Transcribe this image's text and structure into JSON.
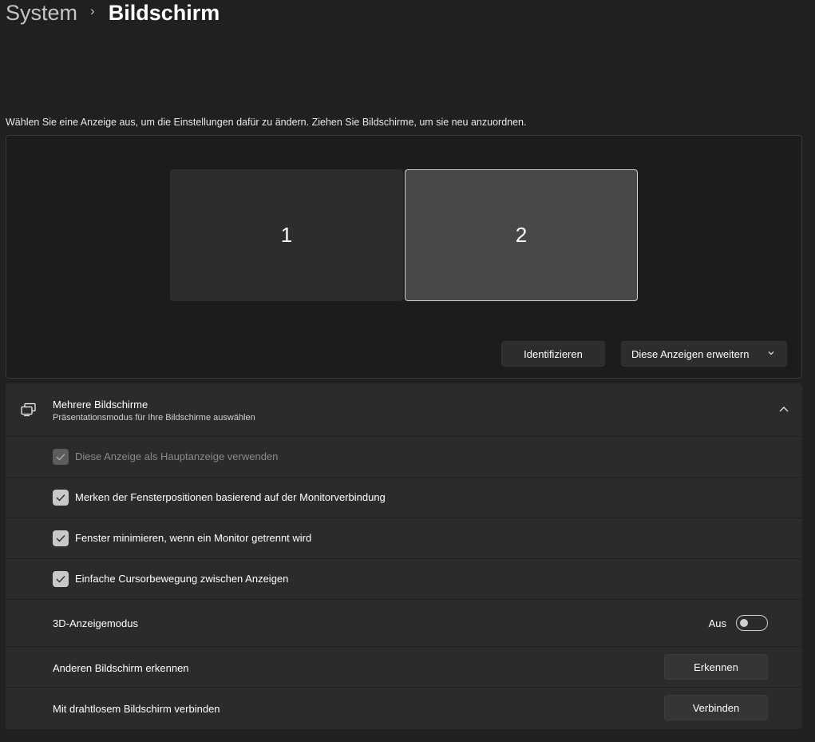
{
  "breadcrumb": {
    "parent": "System",
    "separator": "›",
    "current": "Bildschirm"
  },
  "instruction": "Wählen Sie eine Anzeige aus, um die Einstellungen dafür zu ändern. Ziehen Sie Bildschirme, um sie neu anzuordnen.",
  "arrangement": {
    "monitors": [
      {
        "label": "1",
        "selected": false
      },
      {
        "label": "2",
        "selected": true
      }
    ],
    "identify_label": "Identifizieren",
    "mode_dropdown": {
      "selected": "Diese Anzeigen erweitern",
      "icon": "chevron-down-icon"
    }
  },
  "multiple_displays": {
    "icon": "multiple-displays-icon",
    "title": "Mehrere Bildschirme",
    "subtitle": "Präsentationsmodus für Ihre Bildschirme auswählen",
    "expanded": true,
    "collapse_icon": "chevron-up-icon",
    "checkbox_options": [
      {
        "label": "Diese Anzeige als Hauptanzeige verwenden",
        "checked": true,
        "disabled": true
      },
      {
        "label": "Merken der Fensterpositionen basierend auf der Monitorverbindung",
        "checked": true,
        "disabled": false
      },
      {
        "label": "Fenster minimieren, wenn ein Monitor getrennt wird",
        "checked": true,
        "disabled": false
      },
      {
        "label": "Einfache Cursorbewegung zwischen Anzeigen",
        "checked": true,
        "disabled": false
      }
    ],
    "mode_3d": {
      "label": "3D-Anzeigemodus",
      "state_label": "Aus",
      "on": false
    },
    "detect": {
      "label": "Anderen Bildschirm erkennen",
      "button_label": "Erkennen"
    },
    "wireless": {
      "label": "Mit drahtlosem Bildschirm verbinden",
      "button_label": "Verbinden"
    }
  },
  "colors": {
    "background": "#202020",
    "card": "#2b2b2b",
    "selected_monitor": "#4a4847",
    "checkbox_checked": "#c8c8c8"
  }
}
